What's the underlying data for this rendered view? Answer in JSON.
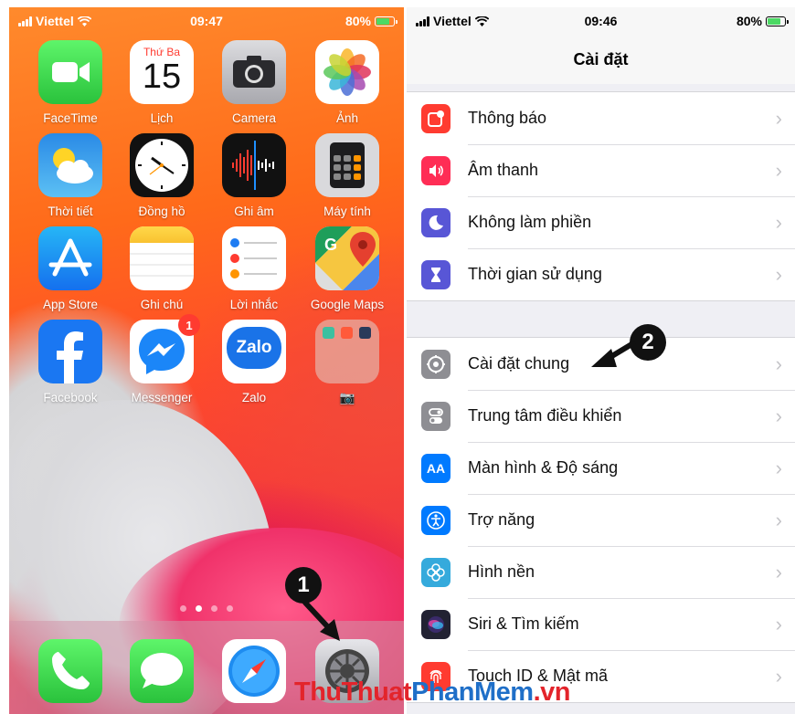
{
  "home": {
    "status": {
      "carrier": "Viettel",
      "time": "09:47",
      "battery": "80%"
    },
    "apps": [
      {
        "name": "facetime",
        "label": "FaceTime",
        "icon": "video-camera-icon"
      },
      {
        "name": "calendar",
        "label": "Lịch",
        "icon": "calendar-icon",
        "day": "Thứ Ba",
        "date": "15"
      },
      {
        "name": "camera",
        "label": "Camera",
        "icon": "camera-icon"
      },
      {
        "name": "photos",
        "label": "Ảnh",
        "icon": "photos-flower-icon"
      },
      {
        "name": "weather",
        "label": "Thời tiết",
        "icon": "weather-sun-cloud-icon"
      },
      {
        "name": "clock",
        "label": "Đồng hồ",
        "icon": "clock-icon"
      },
      {
        "name": "voice-memos",
        "label": "Ghi âm",
        "icon": "waveform-icon"
      },
      {
        "name": "calculator",
        "label": "Máy tính",
        "icon": "calculator-icon"
      },
      {
        "name": "app-store",
        "label": "App Store",
        "icon": "app-store-icon"
      },
      {
        "name": "notes",
        "label": "Ghi chú",
        "icon": "notes-icon"
      },
      {
        "name": "reminders",
        "label": "Lời nhắc",
        "icon": "reminders-icon"
      },
      {
        "name": "google-maps",
        "label": "Google Maps",
        "icon": "map-pin-icon"
      },
      {
        "name": "facebook",
        "label": "Facebook",
        "icon": "facebook-f-icon"
      },
      {
        "name": "messenger",
        "label": "Messenger",
        "icon": "messenger-bolt-icon",
        "badge": "1"
      },
      {
        "name": "zalo",
        "label": "Zalo",
        "icon": "zalo-icon",
        "text": "Zalo"
      },
      {
        "name": "folder",
        "label": "📷",
        "icon": "app-folder-icon"
      }
    ],
    "dock": [
      {
        "name": "phone",
        "icon": "phone-icon"
      },
      {
        "name": "messages",
        "icon": "speech-bubble-icon"
      },
      {
        "name": "safari",
        "icon": "compass-icon"
      },
      {
        "name": "settings",
        "icon": "gear-icon"
      }
    ],
    "step": "1"
  },
  "settings": {
    "status": {
      "carrier": "Viettel",
      "time": "09:46",
      "battery": "80%"
    },
    "title": "Cài đặt",
    "step": "2",
    "group1": [
      {
        "label": "Thông báo",
        "icon": "notification-icon",
        "color": "#ff3b30"
      },
      {
        "label": "Âm thanh",
        "icon": "speaker-icon",
        "color": "#ff2d55"
      },
      {
        "label": "Không làm phiền",
        "icon": "moon-icon",
        "color": "#5856d6"
      },
      {
        "label": "Thời gian sử dụng",
        "icon": "hourglass-icon",
        "color": "#5856d6"
      }
    ],
    "group2": [
      {
        "label": "Cài đặt chung",
        "icon": "gear-icon",
        "color": "#8e8e93"
      },
      {
        "label": "Trung tâm điều khiển",
        "icon": "toggle-switches-icon",
        "color": "#8e8e93"
      },
      {
        "label": "Màn hình & Độ sáng",
        "icon": "aa-text-icon",
        "color": "#007aff",
        "glyph": "AA"
      },
      {
        "label": "Trợ năng",
        "icon": "accessibility-icon",
        "color": "#007aff"
      },
      {
        "label": "Hình nền",
        "icon": "flower-icon",
        "color": "#35aadc"
      },
      {
        "label": "Siri & Tìm kiếm",
        "icon": "siri-icon",
        "color": "#222233"
      },
      {
        "label": "Touch ID & Mật mã",
        "icon": "fingerprint-icon",
        "color": "#ff3b30"
      }
    ]
  },
  "watermark": {
    "part1": "ThuThuat",
    "part2": "PhanMem",
    "part3": ".vn"
  }
}
